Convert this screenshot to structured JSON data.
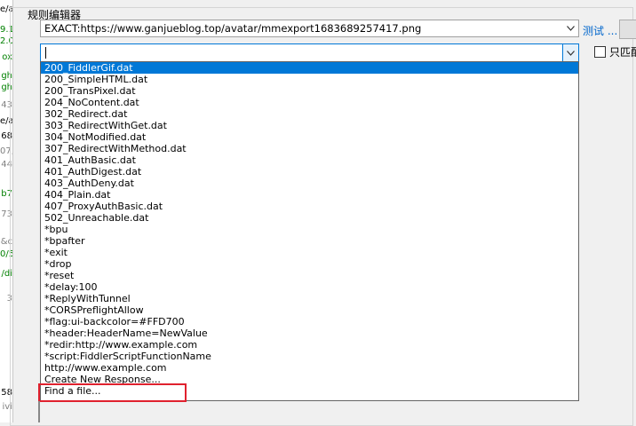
{
  "left_fragments": [
    {
      "text": "e/a",
      "color": "#000000"
    },
    {
      "text": "9.1",
      "color": "#008000"
    },
    {
      "text": "2.0",
      "color": "#008000"
    },
    {
      "text": "ox",
      "color": "#008000"
    },
    {
      "text": "gh",
      "color": "#008000"
    },
    {
      "text": "gh",
      "color": "#008000"
    },
    {
      "text": "43",
      "color": "#808080"
    },
    {
      "text": "e/a",
      "color": "#000000"
    },
    {
      "text": "68",
      "color": "#000000"
    },
    {
      "text": "07,",
      "color": "#808080"
    },
    {
      "text": "44",
      "color": "#808080"
    },
    {
      "text": "b7",
      "color": "#008000"
    },
    {
      "text": "73",
      "color": "#808080"
    },
    {
      "text": "&c",
      "color": "#808080"
    },
    {
      "text": "0/5",
      "color": "#008000"
    },
    {
      "text": "/di",
      "color": "#008000"
    },
    {
      "text": "3",
      "color": "#808080"
    },
    {
      "text": "58",
      "color": "#000000"
    },
    {
      "text": "ivi",
      "color": "#808080"
    }
  ],
  "rule_editor": {
    "title": "规则编辑器",
    "match_value": "EXACT:https://www.ganjueblog.top/avatar/mmexport1683689257417.png",
    "action_value": "",
    "test_link": "测试 ...",
    "small_button_label": "",
    "match_only_label": "只匹配"
  },
  "dropdown": {
    "items": [
      "200_FiddlerGif.dat",
      "200_SimpleHTML.dat",
      "200_TransPixel.dat",
      "204_NoContent.dat",
      "302_Redirect.dat",
      "303_RedirectWithGet.dat",
      "304_NotModified.dat",
      "307_RedirectWithMethod.dat",
      "401_AuthBasic.dat",
      "401_AuthDigest.dat",
      "403_AuthDeny.dat",
      "404_Plain.dat",
      "407_ProxyAuthBasic.dat",
      "502_Unreachable.dat",
      "*bpu",
      "*bpafter",
      "*exit",
      "*drop",
      "*reset",
      "*delay:100",
      "*ReplyWithTunnel",
      "*CORSPreflightAllow",
      "*flag:ui-backcolor=#FFD700",
      "*header:HeaderName=NewValue",
      "*redir:http://www.example.com",
      "*script:FiddlerScriptFunctionName",
      "http://www.example.com",
      "Create New Response..."
    ],
    "selected_index": 0,
    "find_file_label": "Find a file..."
  },
  "colors": {
    "selection": "#0078d7",
    "highlight_box": "#e0212e",
    "link": "#0066cc"
  }
}
